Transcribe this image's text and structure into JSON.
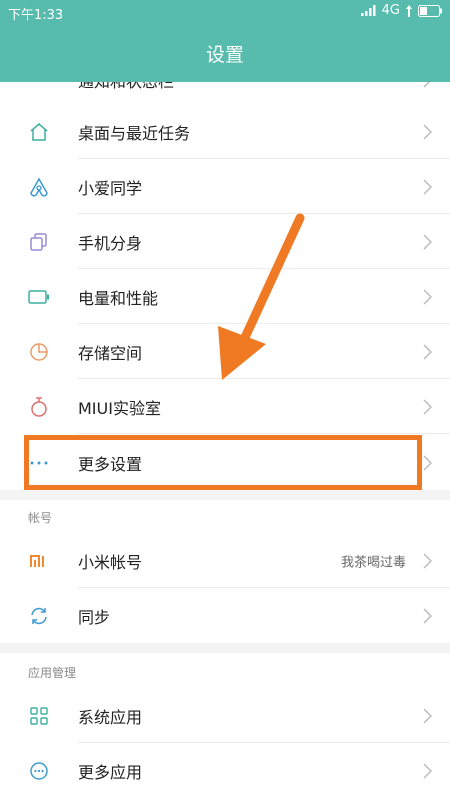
{
  "status_bar": {
    "time": "下午1:33",
    "network": "4G"
  },
  "header": {
    "title": "设置"
  },
  "partial_item": {
    "label": "通知和状态栏"
  },
  "items": [
    {
      "label": "桌面与最近任务",
      "icon": "home-icon"
    },
    {
      "label": "小爱同学",
      "icon": "ai-assistant-icon"
    },
    {
      "label": "手机分身",
      "icon": "second-space-icon"
    },
    {
      "label": "电量和性能",
      "icon": "battery-icon"
    },
    {
      "label": "存储空间",
      "icon": "storage-icon"
    },
    {
      "label": "MIUI实验室",
      "icon": "lab-flask-icon"
    },
    {
      "label": "更多设置",
      "icon": "more-dots-icon"
    }
  ],
  "account_section": {
    "title": "帐号",
    "items": [
      {
        "label": "小米帐号",
        "value": "我茶喝过毒",
        "icon": "mi-logo-icon"
      },
      {
        "label": "同步",
        "icon": "sync-icon"
      }
    ]
  },
  "apps_section": {
    "title": "应用管理",
    "items": [
      {
        "label": "系统应用",
        "icon": "grid-apps-icon"
      },
      {
        "label": "更多应用",
        "icon": "more-apps-icon"
      }
    ]
  },
  "colors": {
    "header": "#57bcad",
    "accent": "#3dafa0",
    "annotation": "#f07a24"
  }
}
